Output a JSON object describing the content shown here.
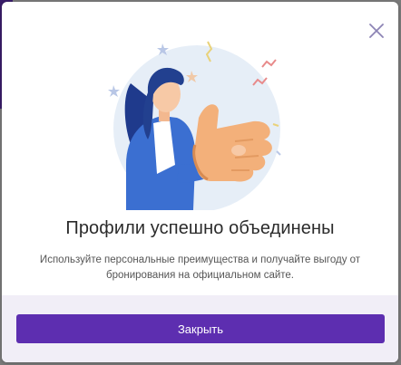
{
  "modal": {
    "title": "Профили успешно объединены",
    "description": "Используйте персональные преимущества и получайте выгоду от бронирования на официальном сайте.",
    "close_icon": "close-icon",
    "illustration": "thumbs-up-woman-illustration"
  },
  "footer": {
    "close_button_label": "Закрыть"
  },
  "colors": {
    "accent": "#5d2eb0",
    "footer_bg": "#f1eef7",
    "close_icon": "#8d84b5"
  }
}
